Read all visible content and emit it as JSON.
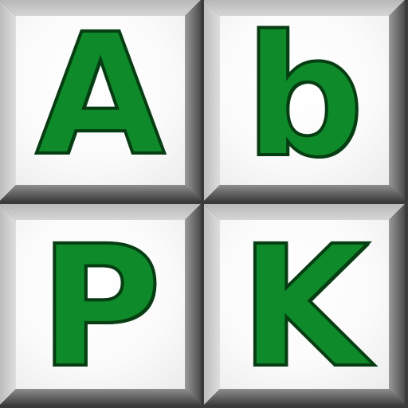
{
  "tiles": [
    {
      "letter": "A"
    },
    {
      "letter": "b"
    },
    {
      "letter": "P"
    },
    {
      "letter": "K"
    }
  ],
  "colors": {
    "letter_fill": "#0e8a2a",
    "letter_outline": "#063d12",
    "face": "#ffffff",
    "gap": "#3a3a3a"
  }
}
